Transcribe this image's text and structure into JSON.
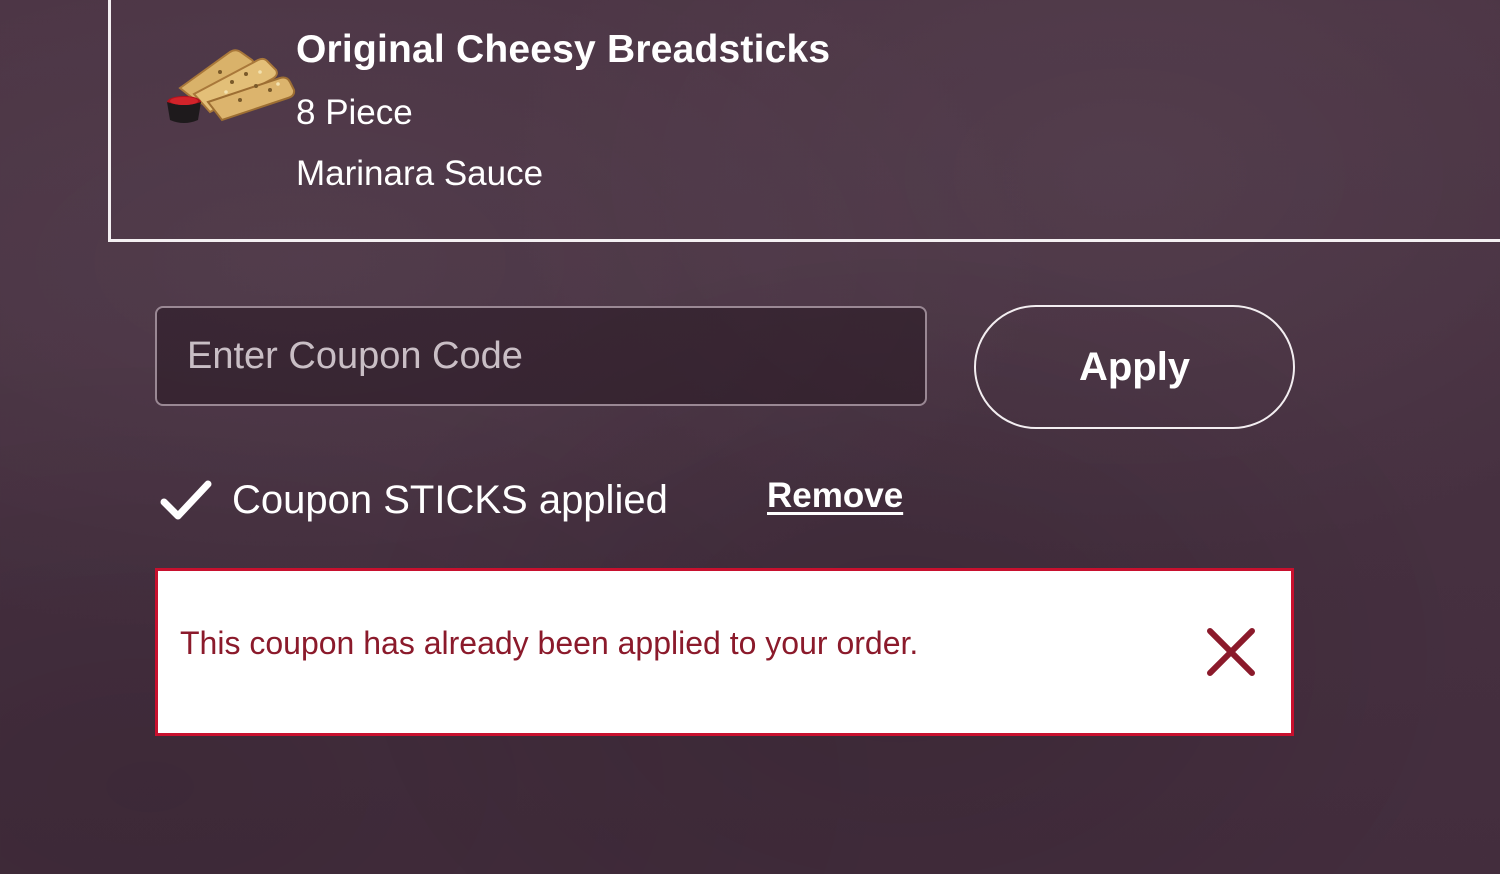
{
  "cart_item": {
    "title": "Original Cheesy Breadsticks",
    "size": "8 Piece",
    "sauce": "Marinara Sauce",
    "image_icon": "breadsticks-image"
  },
  "coupon": {
    "placeholder": "Enter Coupon Code",
    "value": "",
    "apply_label": "Apply",
    "applied_text": "Coupon STICKS applied",
    "remove_label": "Remove"
  },
  "alert": {
    "message": "This coupon has already been applied to your order.",
    "close_icon": "close-icon",
    "border_color": "#c8102e",
    "text_color": "#8b1a2b"
  },
  "colors": {
    "background": "#4a3343",
    "text": "#ffffff"
  }
}
